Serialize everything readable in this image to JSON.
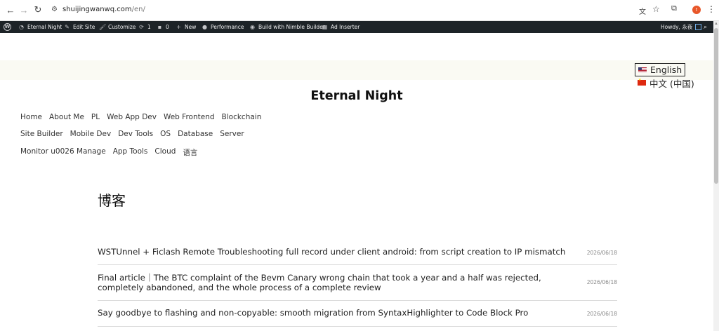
{
  "browser": {
    "url_domain": "shuijingwanwq.com",
    "url_path": "/en/",
    "avatar_initial": "t",
    "icons": [
      "back-icon",
      "forward-icon",
      "reload-icon",
      "site-info-icon",
      "translate-icon",
      "star-icon",
      "extensions-icon",
      "profile-avatar",
      "menu-dots-icon"
    ]
  },
  "adminbar": {
    "site_name": "Eternal Night",
    "edit_site": "Edit Site",
    "customize": "Customize",
    "updates_count": "1",
    "comments_count": "0",
    "new": "New",
    "performance": "Performance",
    "nimble": "Build with Nimble Builder",
    "ad_inserter": "Ad Inserter",
    "howdy": "Howdy, 永夜"
  },
  "language_switcher": [
    {
      "label": "English",
      "flag": "us",
      "active": true
    },
    {
      "label": "中文 (中国)",
      "flag": "cn",
      "active": false
    }
  ],
  "site": {
    "title": "Eternal Night"
  },
  "menu": {
    "row1": [
      "Home",
      "About Me",
      "PL",
      "Web App Dev",
      "Web Frontend",
      "Blockchain"
    ],
    "row2": [
      "Site Builder",
      "Mobile Dev",
      "Dev Tools",
      "OS",
      "Database",
      "Server"
    ],
    "row3": [
      "Monitor u0026 Manage",
      "App Tools",
      "Cloud",
      "语言"
    ]
  },
  "page": {
    "heading": "博客"
  },
  "posts": [
    {
      "title": "WSTUnnel + Ficlash Remote Troubleshooting full record under client android: from script creation to IP mismatch",
      "date": "2026/06/18"
    },
    {
      "title": "Final article｜The BTC complaint of the Bevm Canary wrong chain that took a year and a half was rejected, completely abandoned, and the whole process of a complete review",
      "date": "2026/06/18"
    },
    {
      "title": "Say goodbye to flashing and non-copyable: smooth migration from SyntaxHighlighter to Code Block Pro",
      "date": "2026/06/18"
    }
  ]
}
